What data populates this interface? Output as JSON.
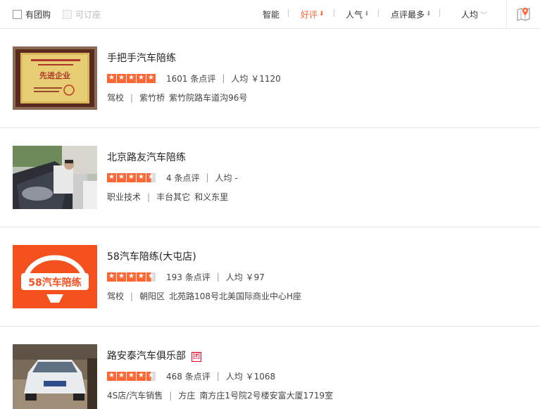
{
  "filters": {
    "group_buy": "有团购",
    "bookable": "可订座"
  },
  "sort": {
    "smart": "智能",
    "good_review": "好评",
    "popularity": "人气",
    "most_reviews": "点评最多",
    "per_capita": "人均",
    "active": "好评"
  },
  "shops": [
    {
      "name": "手把手汽车陪练",
      "stars": 5,
      "reviews": "1601 条点评",
      "price": "人均 ￥1120",
      "category": "驾校",
      "area": "紫竹桥",
      "address": "紫竹院路车道沟96号",
      "tuan": false,
      "thumb_icon": "certificate-plaque-image"
    },
    {
      "name": "北京路友汽车陪练",
      "stars": 4.5,
      "reviews": "4 条点评",
      "price": "人均 -",
      "category": "职业技术",
      "area": "丰台其它",
      "address": "和义东里",
      "tuan": false,
      "thumb_icon": "car-repair-photo"
    },
    {
      "name": "58汽车陪练(大屯店)",
      "stars": 4.5,
      "reviews": "193 条点评",
      "price": "人均 ￥97",
      "category": "驾校",
      "area": "朝阳区",
      "address": "北苑路108号北美国际商业中心H座",
      "tuan": false,
      "thumb_icon": "brand-logo-image"
    },
    {
      "name": "路安泰汽车俱乐部",
      "stars": 4.5,
      "reviews": "468 条点评",
      "price": "人均 ￥1068",
      "category": "4S店/汽车销售",
      "area": "方庄",
      "address": "南方庄1号院2号楼安富大厦1719室",
      "tuan": true,
      "tuan_label": "团",
      "thumb_icon": "white-car-photo"
    }
  ],
  "logo_text": "58汽车陪练",
  "certificate_text": "先进企业"
}
